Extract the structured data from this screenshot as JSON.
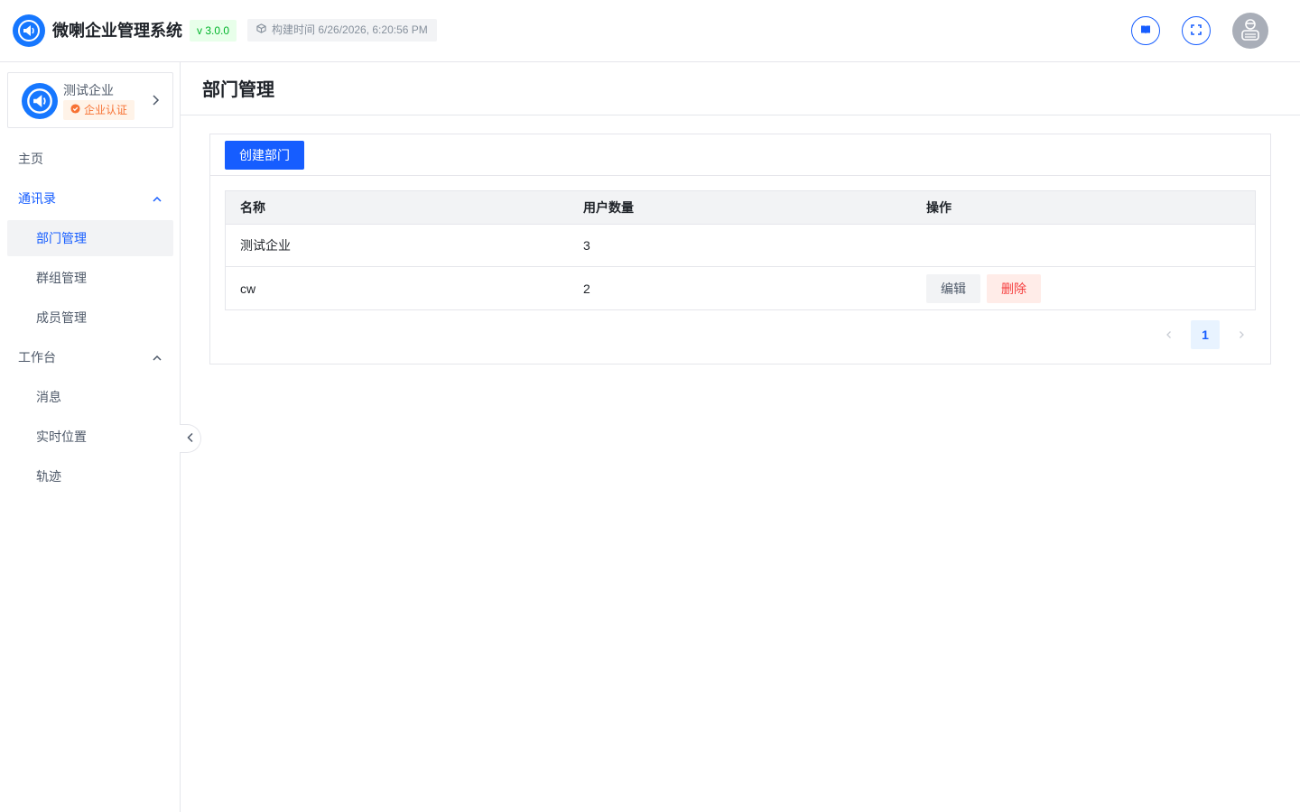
{
  "header": {
    "app_title": "微喇企业管理系统",
    "version": "v 3.0.0",
    "build_time": "构建时间 6/26/2026, 6:20:56 PM",
    "icons": [
      "megaphone-logo-icon",
      "book-icon",
      "fullscreen-icon",
      "user-avatar-icon"
    ]
  },
  "sidebar": {
    "org": {
      "name": "测试企业",
      "badge": "企业认证"
    },
    "menu": {
      "home": "主页",
      "contacts": "通讯录",
      "contacts_items": [
        "部门管理",
        "群组管理",
        "成员管理"
      ],
      "workbench": "工作台",
      "workbench_items": [
        "消息",
        "实时位置",
        "轨迹"
      ]
    }
  },
  "main": {
    "page_title": "部门管理",
    "create_button": "创建部门",
    "table": {
      "columns": [
        "名称",
        "用户数量",
        "操作"
      ],
      "rows": [
        {
          "name": "测试企业",
          "count": "3"
        },
        {
          "name": "cw",
          "count": "2",
          "edit": "编辑",
          "delete": "删除"
        }
      ]
    },
    "pagination": {
      "current": "1"
    }
  },
  "colors": {
    "primary": "#165dff",
    "success": "#00b42a",
    "warning": "#f77234",
    "danger": "#f53f3f"
  }
}
